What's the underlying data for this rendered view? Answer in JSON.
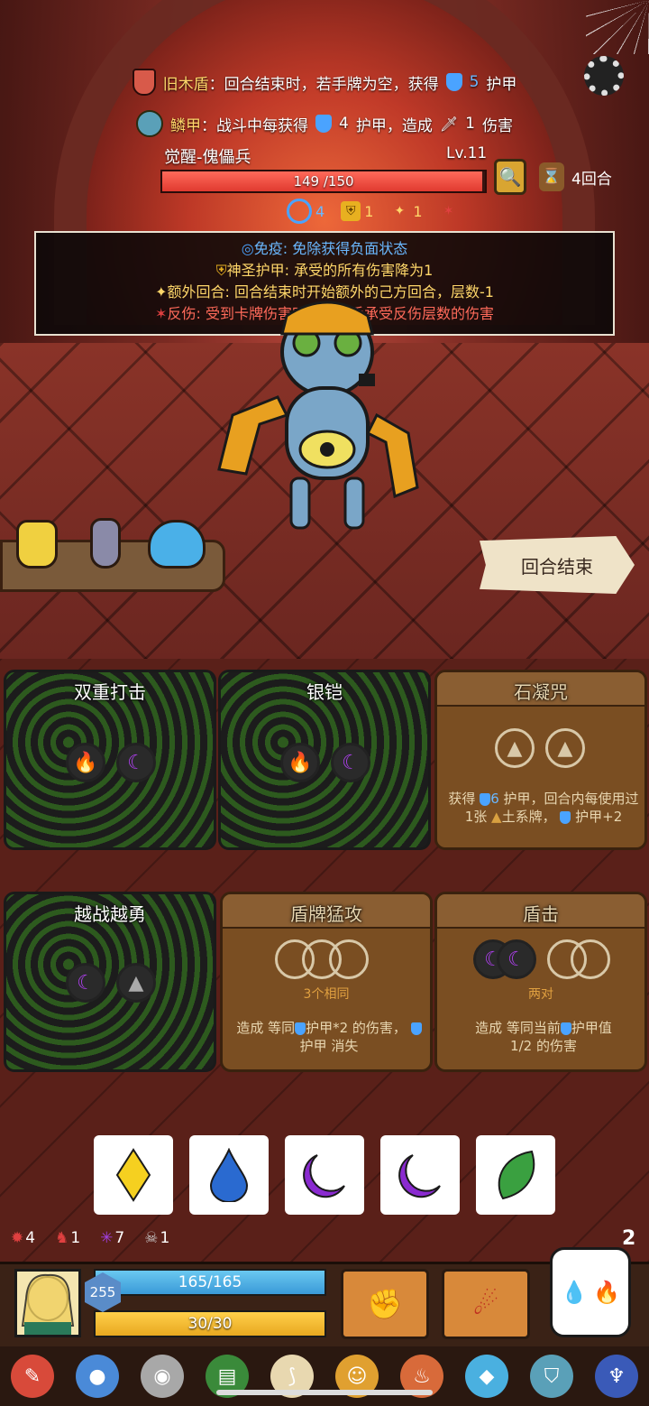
{
  "relics_top": [
    {
      "icon": "old-wood-shield-icon",
      "name": "旧木盾",
      "text_before": "：回合结束时，若手牌为空，获得",
      "value": "5",
      "text_after": "护甲"
    },
    {
      "icon": "scale-armor-icon",
      "name": "鳞甲",
      "text_before": "：战斗中每获得",
      "value": "4",
      "text_mid": "护甲，造成",
      "value2": "1",
      "text_after": "伤害"
    }
  ],
  "enemy": {
    "name": "觉醒-傀儡兵",
    "level": "Lv.11",
    "hp_text": "149 /150",
    "hp_fraction": 0.993,
    "turns": "4回合",
    "statuses": [
      {
        "icon": "immunity-icon",
        "value": "4"
      },
      {
        "icon": "holy-armor-icon",
        "value": "1"
      },
      {
        "icon": "extra-turn-icon",
        "value": "1"
      },
      {
        "icon": "reflect-icon",
        "value": ""
      }
    ]
  },
  "tooltip": [
    {
      "key": "免疫",
      "text": ": 免除获得负面状态"
    },
    {
      "key": "神圣护甲",
      "text": ": 承受的所有伤害降为1"
    },
    {
      "key": "额外回合",
      "text": ": 回合结束时开始额外的己方回合，层数-1"
    },
    {
      "key": "反伤",
      "text": ": 受到卡牌伤害时，使对手承受反伤层数的伤害"
    }
  ],
  "end_turn_label": "回合结束",
  "cards": [
    {
      "title": "双重打击",
      "style": "green"
    },
    {
      "title": "银铠",
      "style": "green"
    },
    {
      "title": "石凝咒",
      "style": "brown",
      "desc_parts": [
        "获得",
        "6",
        "护甲，回合内每使用过1张",
        "土系牌，",
        "护甲+2"
      ]
    },
    {
      "title": "越战越勇",
      "style": "green"
    },
    {
      "title": "盾牌猛攻",
      "style": "brown",
      "req": "3个相同",
      "desc_parts": [
        "造成 等同",
        "护甲*2 的伤害，",
        "护甲 消失"
      ]
    },
    {
      "title": "盾击",
      "style": "brown",
      "req": "两对",
      "desc_parts": [
        "造成 等同当前",
        "护甲值",
        "1/2 的伤害"
      ]
    }
  ],
  "dice_hand": [
    {
      "icon": "yellow-diamond-icon",
      "color": "#f5d020"
    },
    {
      "icon": "blue-drop-icon",
      "color": "#2a6ad0"
    },
    {
      "icon": "purple-moon-icon",
      "color": "#8a2ad0"
    },
    {
      "icon": "purple-moon-icon",
      "color": "#8a2ad0"
    },
    {
      "icon": "green-leaf-icon",
      "color": "#3aa040"
    }
  ],
  "player_effects": [
    {
      "icon": "burn-gear-icon",
      "value": "4"
    },
    {
      "icon": "rage-demon-icon",
      "value": "1"
    },
    {
      "icon": "spark-icon",
      "value": "7"
    },
    {
      "icon": "skull-icon",
      "value": "1"
    }
  ],
  "draw_count": "2",
  "player": {
    "armor": "255",
    "hp_text": "165/165",
    "energy_text": "30/30",
    "hp_fraction": 1.0,
    "energy_fraction": 1.0
  }
}
